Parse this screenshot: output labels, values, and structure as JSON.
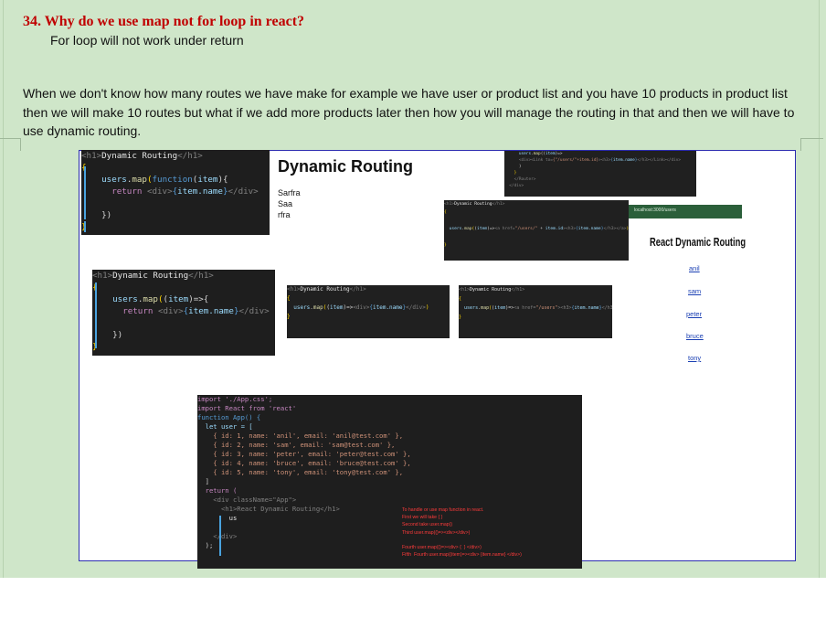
{
  "question": "34. Why do we use map not for loop in react?",
  "answer": "For loop will not work under return",
  "paragraph": "When we don't know how many routes we have make for example we have user or product list  and you have 10 products in product list then we will make 10 routes but what if we add more products later then how you will manage the routing in that and then we will have to use dynamic routing.",
  "figure": {
    "render1": {
      "title": "Dynamic Routing",
      "items": [
        "Sarfra",
        "Saa",
        "rfra"
      ]
    },
    "render2": {
      "window_label": "localhost:3000/users",
      "title": "React Dynamic Routing",
      "links": [
        "anil",
        "sam",
        "peter",
        "bruce",
        "tony"
      ]
    },
    "code_app": {
      "line1": "import './App.css';",
      "line2": "import React from 'react'",
      "line3": "function App() {",
      "line4": "  let user = [",
      "users": [
        "    { id: 1, name: 'anil', email: 'anil@test.com' },",
        "    { id: 2, name: 'sam', email: 'sam@test.com' },",
        "    { id: 3, name: 'peter', email: 'peter@test.com' },",
        "    { id: 4, name: 'bruce', email: 'bruce@test.com' },",
        "    { id: 5, name: 'tony', email: 'tony@test.com' },"
      ],
      "line10": "  ]",
      "line11": "  return (",
      "line12": "    <div className=\"App\">",
      "line13": "      <h1>React Dynamic Routing</h1>",
      "line14": "        us",
      "line15": "    </div>",
      "line16": "  );"
    },
    "notes": [
      "To handle or use map function in react.",
      "First we will take { }",
      "Second take user.map()",
      "Third user.map(()=><div></div>)"
    ],
    "notes2": [
      "Fourth user.map(()=><div> {  } </div>)",
      "Fifth  Fourth user.map((item)=><div> {item.name} </div>)"
    ]
  }
}
